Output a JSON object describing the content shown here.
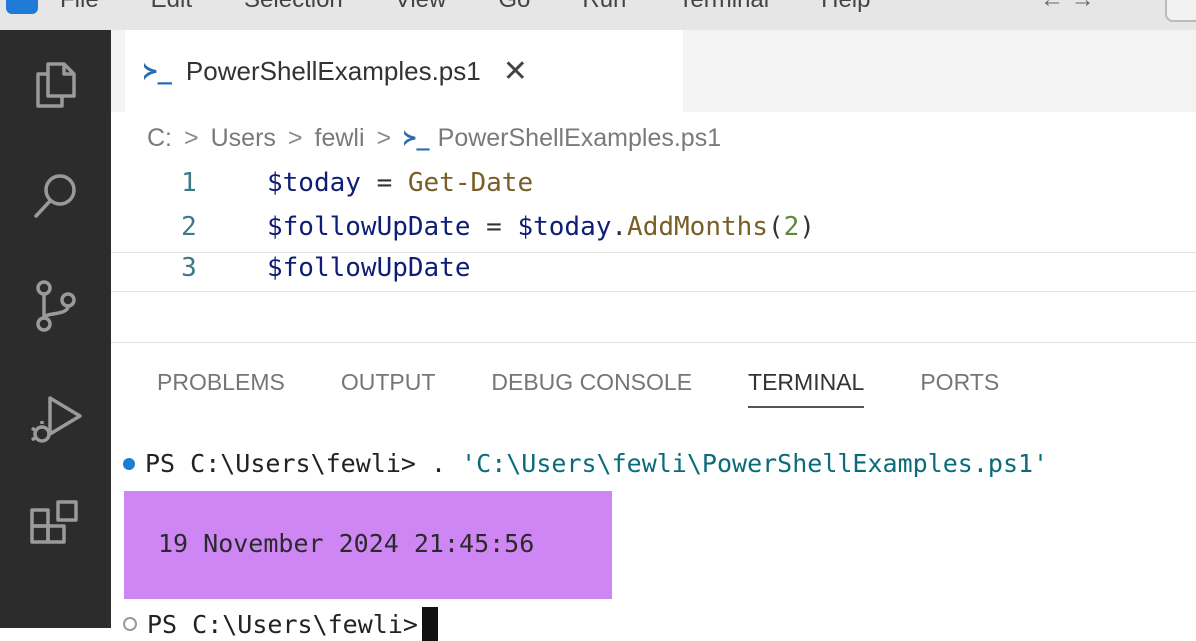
{
  "menubar": {
    "items": [
      "File",
      "Edit",
      "Selection",
      "View",
      "Go",
      "Run",
      "Terminal",
      "Help"
    ],
    "nav": "←  →"
  },
  "activitybar": {
    "icons": [
      "files-icon",
      "search-icon",
      "source-control-icon",
      "run-debug-icon",
      "extensions-icon"
    ]
  },
  "tab": {
    "icon": "≻_",
    "label": "PowerShellExamples.ps1",
    "close": "✕"
  },
  "breadcrumb": {
    "parts": [
      "C:",
      "Users",
      "fewli"
    ],
    "separator": ">",
    "file_icon": "≻_",
    "file": "PowerShellExamples.ps1"
  },
  "code": {
    "lines": [
      {
        "number": "1",
        "tokens": [
          [
            "var",
            "$today"
          ],
          [
            "op",
            " = "
          ],
          [
            "fn",
            "Get-Date"
          ]
        ]
      },
      {
        "number": "2",
        "tokens": [
          [
            "var",
            "$followUpDate"
          ],
          [
            "op",
            " = "
          ],
          [
            "var",
            "$today"
          ],
          [
            "punc",
            "."
          ],
          [
            "fn",
            "AddMonths"
          ],
          [
            "punc",
            "("
          ],
          [
            "num",
            "2"
          ],
          [
            "punc",
            ")"
          ]
        ]
      },
      {
        "number": "3",
        "tokens": [
          [
            "var",
            "$followUpDate"
          ]
        ]
      }
    ]
  },
  "panel": {
    "tabs": [
      "PROBLEMS",
      "OUTPUT",
      "DEBUG CONSOLE",
      "TERMINAL",
      "PORTS"
    ],
    "active_tab": "TERMINAL"
  },
  "terminal": {
    "prompt": "PS C:\\Users\\fewli>",
    "command_dot": " . ",
    "command_path": "'C:\\Users\\fewli\\PowerShellExamples.ps1'",
    "output": "19 November 2024 21:45:56",
    "prompt2": "PS C:\\Users\\fewli>"
  },
  "colors": {
    "activitybar": "#2c2c2c",
    "highlight": "#cf86f5",
    "accent": "#1a7fd4"
  }
}
